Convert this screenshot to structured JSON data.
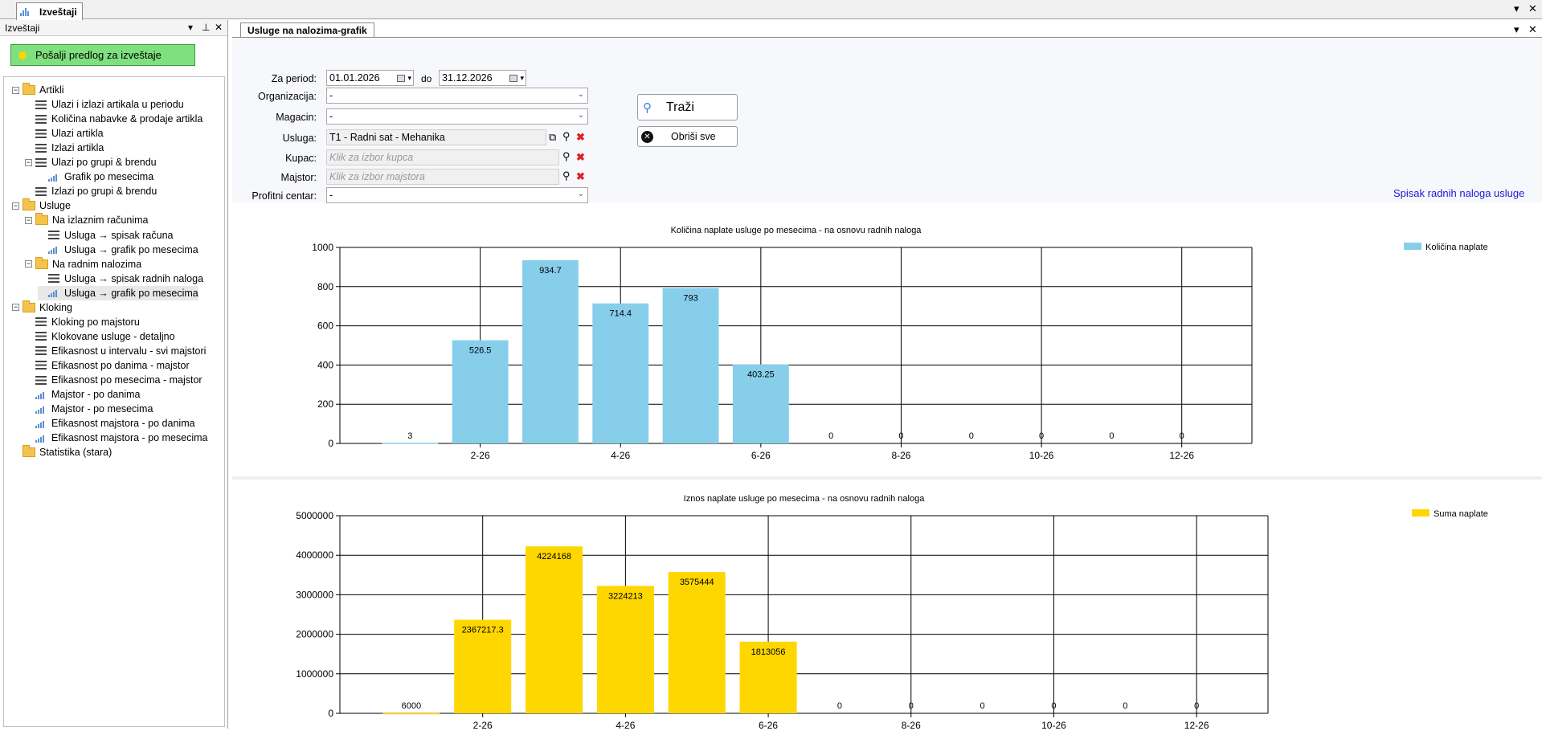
{
  "window": {
    "tab_title": "Izveštaji"
  },
  "left_panel": {
    "title": "Izveštaji",
    "send_button": "Pošalji predlog za izveštaje",
    "tree": [
      {
        "label": "Artikli",
        "kind": "folder",
        "level": 0,
        "expander": "−"
      },
      {
        "label": "Ulazi i izlazi artikala u periodu",
        "kind": "list",
        "level": 1
      },
      {
        "label": "Količina nabavke & prodaje artikla",
        "kind": "list",
        "level": 1
      },
      {
        "label": "Ulazi artikla",
        "kind": "list",
        "level": 1
      },
      {
        "label": "Izlazi artikla",
        "kind": "list",
        "level": 1
      },
      {
        "label": "Ulazi po grupi & brendu",
        "kind": "list",
        "level": 1,
        "expander": "−"
      },
      {
        "label": "Grafik po mesecima",
        "kind": "chart",
        "level": 2
      },
      {
        "label": "Izlazi po grupi & brendu",
        "kind": "list",
        "level": 1
      },
      {
        "label": "Usluge",
        "kind": "folder",
        "level": 0,
        "expander": "−"
      },
      {
        "label": "Na izlaznim računima",
        "kind": "folder",
        "level": 1,
        "expander": "−"
      },
      {
        "label": "Usluga → spisak računa",
        "kind": "list",
        "level": 2
      },
      {
        "label": "Usluga → grafik po mesecima",
        "kind": "chart",
        "level": 2
      },
      {
        "label": "Na radnim nalozima",
        "kind": "folder",
        "level": 1,
        "expander": "−"
      },
      {
        "label": "Usluga → spisak radnih naloga",
        "kind": "list",
        "level": 2
      },
      {
        "label": "Usluga → grafik po mesecima",
        "kind": "chart",
        "level": 2,
        "selected": true
      },
      {
        "label": "Kloking",
        "kind": "folder",
        "level": 0,
        "expander": "−"
      },
      {
        "label": "Kloking po majstoru",
        "kind": "list",
        "level": 1
      },
      {
        "label": "Klokovane usluge - detaljno",
        "kind": "list",
        "level": 1
      },
      {
        "label": "Efikasnost u intervalu - svi majstori",
        "kind": "list",
        "level": 1
      },
      {
        "label": "Efikasnost po danima - majstor",
        "kind": "list",
        "level": 1
      },
      {
        "label": "Efikasnost po mesecima - majstor",
        "kind": "list",
        "level": 1
      },
      {
        "label": "Majstor - po danima",
        "kind": "chart",
        "level": 1
      },
      {
        "label": "Majstor - po mesecima",
        "kind": "chart",
        "level": 1
      },
      {
        "label": "Efikasnost majstora - po danima",
        "kind": "chart",
        "level": 1
      },
      {
        "label": "Efikasnost majstora - po mesecima",
        "kind": "chart",
        "level": 1
      },
      {
        "label": "Statistika (stara)",
        "kind": "folder",
        "level": 0
      }
    ]
  },
  "content": {
    "tab_title": "Usluge na nalozima-grafik",
    "filters": {
      "period_label": "Za period:",
      "date_from": "01.01.2026",
      "to_label": "do",
      "date_to": "31.12.2026",
      "org_label": "Organizacija:",
      "org_value": "-",
      "magacin_label": "Magacin:",
      "magacin_value": "-",
      "usluga_label": "Usluga:",
      "usluga_value": "T1 - Radni sat - Mehanika",
      "kupac_label": "Kupac:",
      "kupac_placeholder": "Klik za izbor kupca",
      "majstor_label": "Majstor:",
      "majstor_placeholder": "Klik za izbor majstora",
      "profit_label": "Profitni centar:",
      "profit_value": "-"
    },
    "search_button": "Traži",
    "clear_button": "Obriši sve",
    "link": "Spisak radnih naloga usluge"
  },
  "chart_data": [
    {
      "type": "bar",
      "title": "Količina naplate usluge po mesecima - na osnovu radnih naloga",
      "categories": [
        "1-26",
        "2-26",
        "3-26",
        "4-26",
        "5-26",
        "6-26",
        "7-26",
        "8-26",
        "9-26",
        "10-26",
        "11-26",
        "12-26"
      ],
      "x_tick_labels": [
        "2-26",
        "4-26",
        "6-26",
        "8-26",
        "10-26",
        "12-26"
      ],
      "series": [
        {
          "name": "Količina naplate",
          "color": "#87ceeb",
          "values": [
            3,
            526.5,
            934.7,
            714.4,
            793,
            403.25,
            0,
            0,
            0,
            0,
            0,
            0
          ]
        }
      ],
      "data_labels": [
        "3",
        "526.5",
        "934.7",
        "714.4",
        "793",
        "403.25",
        "0",
        "0",
        "0",
        "0",
        "0",
        "0"
      ],
      "y_ticks": [
        "0",
        "200",
        "400",
        "600",
        "800",
        "1000"
      ],
      "ylim": [
        0,
        1000
      ],
      "legend": "top-right",
      "grid": true
    },
    {
      "type": "bar",
      "title": "Iznos naplate usluge po mesecima - na osnovu radnih naloga",
      "categories": [
        "1-26",
        "2-26",
        "3-26",
        "4-26",
        "5-26",
        "6-26",
        "7-26",
        "8-26",
        "9-26",
        "10-26",
        "11-26",
        "12-26"
      ],
      "x_tick_labels": [
        "2-26",
        "4-26",
        "6-26",
        "8-26",
        "10-26",
        "12-26"
      ],
      "series": [
        {
          "name": "Suma naplate",
          "color": "#ffd700",
          "values": [
            6000,
            2367217.3,
            4224168,
            3224213,
            3575444,
            1813056,
            0,
            0,
            0,
            0,
            0,
            0
          ]
        }
      ],
      "data_labels": [
        "6000",
        "2367217.3",
        "4224168",
        "3224213",
        "3575444",
        "1813056",
        "0",
        "0",
        "0",
        "0",
        "0",
        "0"
      ],
      "y_ticks": [
        "0",
        "1000000",
        "2000000",
        "3000000",
        "4000000",
        "5000000"
      ],
      "ylim": [
        0,
        5000000
      ],
      "legend": "top-right",
      "grid": true
    }
  ]
}
